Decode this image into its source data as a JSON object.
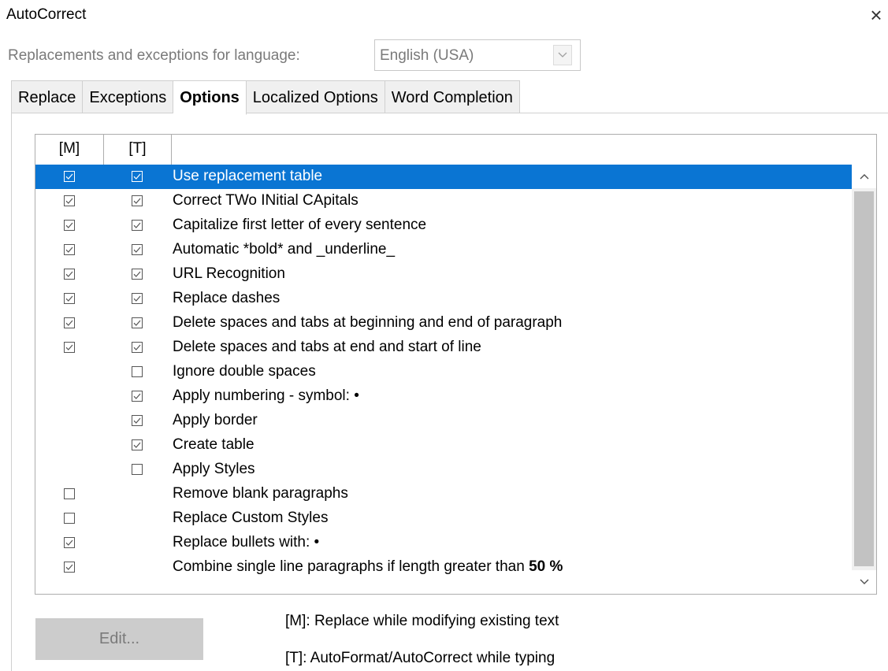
{
  "window": {
    "title": "AutoCorrect",
    "close_glyph": "×"
  },
  "language": {
    "label": "Replacements and exceptions for language:",
    "value": "English (USA)"
  },
  "tabs": [
    {
      "label": "Replace",
      "active": false
    },
    {
      "label": "Exceptions",
      "active": false
    },
    {
      "label": "Options",
      "active": true
    },
    {
      "label": "Localized Options",
      "active": false
    },
    {
      "label": "Word Completion",
      "active": false
    }
  ],
  "list": {
    "headers": {
      "m": "[M]",
      "t": "[T]",
      "label": ""
    },
    "rows": [
      {
        "m": true,
        "t": true,
        "label": "Use replacement table",
        "selected": true
      },
      {
        "m": true,
        "t": true,
        "label": "Correct TWo INitial CApitals"
      },
      {
        "m": true,
        "t": true,
        "label": "Capitalize first letter of every sentence"
      },
      {
        "m": true,
        "t": true,
        "label": "Automatic *bold* and _underline_"
      },
      {
        "m": true,
        "t": true,
        "label": "URL Recognition"
      },
      {
        "m": true,
        "t": true,
        "label": "Replace dashes"
      },
      {
        "m": true,
        "t": true,
        "label": "Delete spaces and tabs at beginning and end of paragraph"
      },
      {
        "m": true,
        "t": true,
        "label": "Delete spaces and tabs at end and start of line"
      },
      {
        "m": null,
        "t": false,
        "label": "Ignore double spaces"
      },
      {
        "m": null,
        "t": true,
        "label": "Apply numbering - symbol: •"
      },
      {
        "m": null,
        "t": true,
        "label": "Apply border"
      },
      {
        "m": null,
        "t": true,
        "label": "Create table"
      },
      {
        "m": null,
        "t": false,
        "label": "Apply Styles"
      },
      {
        "m": false,
        "t": null,
        "label": "Remove blank paragraphs"
      },
      {
        "m": false,
        "t": null,
        "label": "Replace Custom Styles"
      },
      {
        "m": true,
        "t": null,
        "label": "Replace bullets with: •"
      },
      {
        "m": true,
        "t": null,
        "label": "Combine single line paragraphs if length greater than",
        "bold_suffix": "50 %"
      }
    ]
  },
  "edit_button": {
    "label": "Edit..."
  },
  "notes": {
    "m": "[M]: Replace while modifying existing text",
    "t": "[T]: AutoFormat/AutoCorrect while typing"
  },
  "colors": {
    "selection": "#0a75d3"
  },
  "icons": {
    "close": "close-icon",
    "dropdown": "chevron-down-icon",
    "scroll_up": "chevron-up-icon",
    "scroll_down": "chevron-down-icon"
  }
}
